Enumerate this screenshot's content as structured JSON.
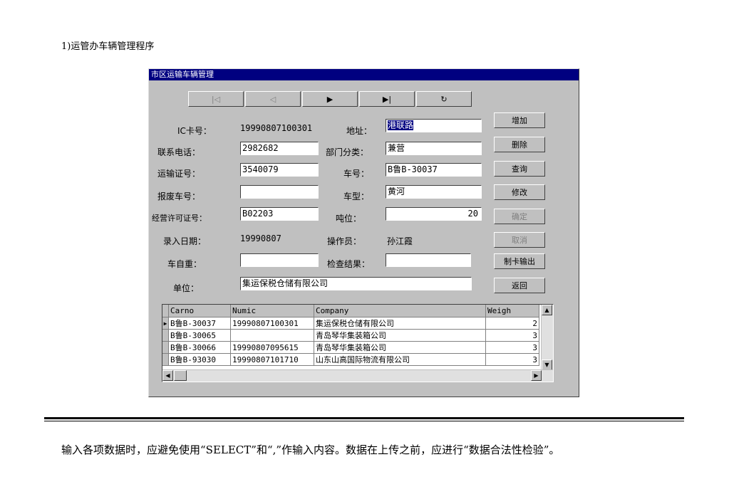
{
  "doc": {
    "heading": "1)运管办车辆管理程序",
    "note": "输入各项数据时，应避免使用“SELECT”和“,”作输入内容。数据在上传之前，应进行“数据合法性检验”。"
  },
  "window": {
    "title": "市区运输车辆管理"
  },
  "nav": {
    "first": "|◁",
    "prev": "◁",
    "next": "▶",
    "last": "▶|",
    "refresh": "↻"
  },
  "form": {
    "ic_label": "IC卡号：",
    "ic_value": "19990807100301",
    "address_label": "地址：",
    "address_value": "港联路",
    "phone_label": "联系电话：",
    "phone_value": "2982682",
    "dept_label": "部门分类：",
    "dept_value": "兼营",
    "transport_label": "运输证号：",
    "transport_value": "3540079",
    "plate_label": "车号：",
    "plate_value": "B鲁B-30037",
    "scrap_label": "报废车号：",
    "scrap_value": "",
    "model_label": "车型：",
    "model_value": "黄河",
    "license_label": "经营许可证号：",
    "license_value": "B02203",
    "tonnage_label": "吨位：",
    "tonnage_value": "20",
    "date_label": "录入日期：",
    "date_value": "19990807",
    "operator_label": "操作员：",
    "operator_value": "孙江霞",
    "weight_label": "车自重：",
    "weight_value": "",
    "check_label": "检查结果：",
    "check_value": "",
    "unit_label": "单位：",
    "unit_value": "集运保税仓储有限公司"
  },
  "buttons": {
    "add": "增加",
    "delete": "删除",
    "query": "查询",
    "modify": "修改",
    "confirm": "确定",
    "cancel": "取消",
    "make_card": "制卡输出",
    "back": "返回"
  },
  "grid": {
    "columns": [
      "Carno",
      "Numic",
      "Company",
      "Weigh"
    ],
    "rows": [
      [
        "B鲁B-30037",
        "19990807100301",
        "集运保税仓储有限公司",
        "2"
      ],
      [
        "B鲁B-30065",
        "",
        "青岛琴华集装箱公司",
        "3"
      ],
      [
        "B鲁B-30066",
        "19990807095615",
        "青岛琴华集装箱公司",
        "3"
      ],
      [
        "B鲁B-93030",
        "19990807101710",
        "山东山高国际物流有限公司",
        "3"
      ]
    ]
  }
}
